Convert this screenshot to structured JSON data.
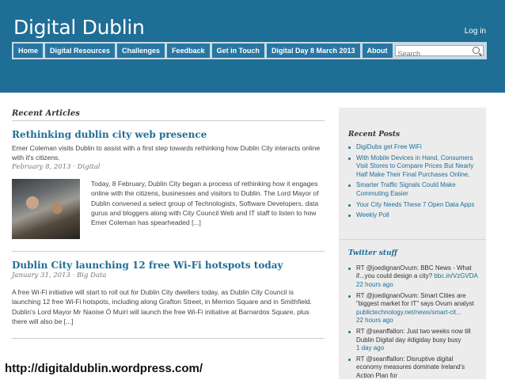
{
  "site": {
    "title": "Digital Dublin",
    "login_label": "Log in"
  },
  "nav": {
    "items": [
      "Home",
      "Digital Resources",
      "Challenges",
      "Feedback",
      "Get in Touch",
      "Digital Day 8 March 2013",
      "About"
    ],
    "search_placeholder": "Search"
  },
  "main": {
    "section_title": "Recent Articles",
    "articles": [
      {
        "title": "Rethinking dublin city web presence",
        "excerpt": "Emer Coleman visits Dublin to assist with a first step towards rethinking how Dublin City interacts online with it's citizens.",
        "meta": "February 8, 2013 · Digital",
        "body": "Today, 8 February, Dublin City began a process of rethinking how it engages online with the citizens, businesses and visitors to Dublin. The Lord Mayor of Dublin convened a select group of Technologists, Software Developers, data gurus and bloggers along with City Council Web and IT staff to listen to how Emer Coleman has spearheaded [...]"
      },
      {
        "title": "Dublin City launching 12 free Wi-Fi hotspots today",
        "meta": "January 31, 2013 · Big Data",
        "body": "A free Wi-Fi initiative will start to roll out for Dublin City dwellers today, as Dublin City Council is launching 12 free Wi-Fi hotspots, including along Grafton Street, in Merrion Square and in Smithfield. Dublin's Lord Mayor Mr Naoise Ó Muirí will launch the free Wi-Fi initiative at Barnardos Square, plus there will also be [...]"
      }
    ]
  },
  "sidebar": {
    "recent_posts_title": "Recent Posts",
    "recent_posts": [
      "DigiDubs get Free WiFi",
      "With Mobile Devices in Hand, Consumers Visit Stores to Compare Prices But Nearly Half Make Their Final Purchases Online,",
      "Smarter Traffic Signals Could Make Commuting Easier",
      "Your City Needs These 7 Open Data Apps",
      "Weekly Poll"
    ],
    "twitter_title": "Twitter stuff",
    "tweets": [
      {
        "text": "RT @joedignanOvum: BBC News - What if...you could design a city?",
        "link": "bbc.in/VzGVDA",
        "time": "22 hours ago"
      },
      {
        "text": "RT @joedignanOvum: Smart Cities are \"biggest market for IT\" says Ovum analyst",
        "link": "publictechnology.net/news/smart-cit...",
        "time": "22 hours ago"
      },
      {
        "text": "RT @seanffallon: Just two weeks now till Dublin Digital day #digiday busy busy",
        "link": "",
        "time": "1 day ago"
      },
      {
        "text": "RT @seanffallon: Disruptive digital economy measures dominate Ireland's Action Plan for",
        "link": "",
        "time": ""
      }
    ]
  },
  "footer_url": "http://digitaldublin.wordpress.com/",
  "colors": {
    "header": "#1f6e96",
    "nav_button": "#2877a3",
    "link": "#1f6e96",
    "sidebar": "#ececec"
  }
}
